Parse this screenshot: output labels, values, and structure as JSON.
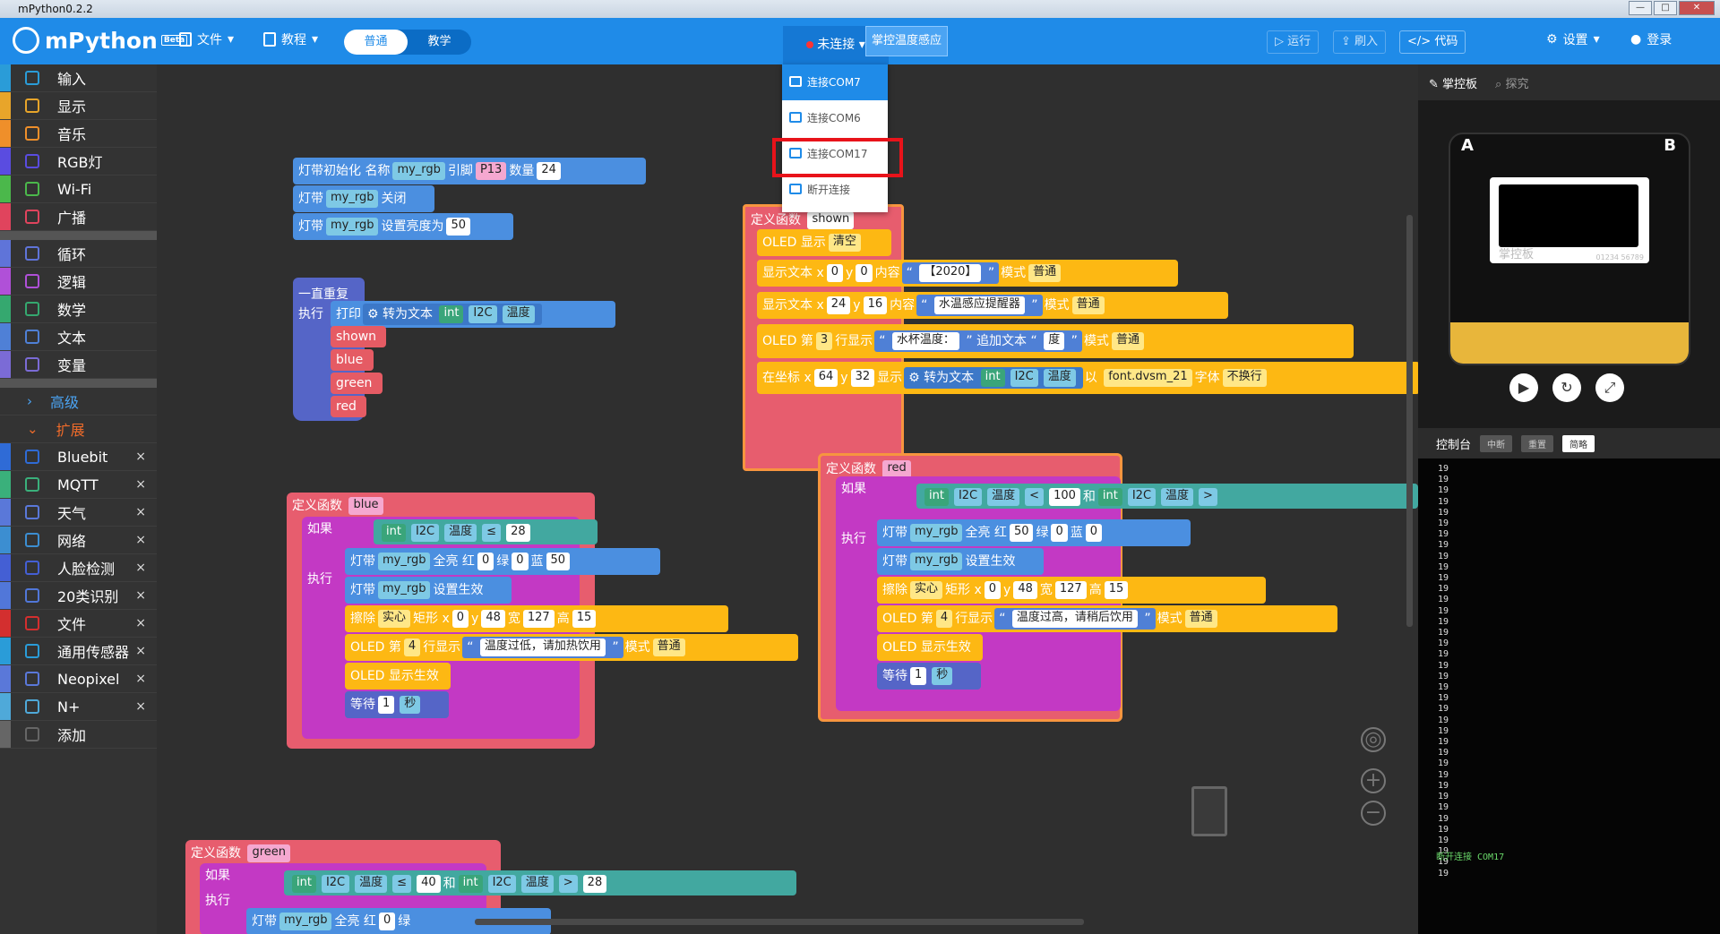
{
  "window": {
    "title": "mPython0.2.2"
  },
  "toolbar": {
    "logo": "mPython",
    "version": "Beta",
    "file": "文件",
    "tutorial": "教程",
    "mode_normal": "普通",
    "mode_teach": "教学",
    "connect": "未连接",
    "board": "掌控温度感应",
    "run": "运行",
    "flash": "刷入",
    "code": "代码",
    "settings": "设置",
    "login": "登录"
  },
  "dropdown": {
    "items": [
      "连接COM7",
      "连接COM6",
      "连接COM17",
      "断开连接"
    ]
  },
  "sidebar": {
    "items": [
      {
        "label": "输入",
        "color": "#2a9cd8"
      },
      {
        "label": "显示",
        "color": "#e8a52a"
      },
      {
        "label": "音乐",
        "color": "#ef8f2a"
      },
      {
        "label": "RGB灯",
        "color": "#5a4ce0"
      },
      {
        "label": "Wi-Fi",
        "color": "#4bb84b"
      },
      {
        "label": "广播",
        "color": "#e0445d"
      }
    ],
    "items2": [
      {
        "label": "循环",
        "color": "#5f74d9"
      },
      {
        "label": "逻辑",
        "color": "#b050d8"
      },
      {
        "label": "数学",
        "color": "#35a86f"
      },
      {
        "label": "文本",
        "color": "#4f80d6"
      },
      {
        "label": "变量",
        "color": "#7b6bd6"
      }
    ],
    "advanced": "高级",
    "extension": "扩展",
    "items3": [
      {
        "label": "Bluebit",
        "color": "#2f6bd6"
      },
      {
        "label": "MQTT",
        "color": "#3ab07b"
      },
      {
        "label": "天气",
        "color": "#5a78d9"
      },
      {
        "label": "网络",
        "color": "#3c8ed1"
      },
      {
        "label": "人脸检测",
        "color": "#445fd4"
      },
      {
        "label": "20类识别",
        "color": "#5177d9"
      },
      {
        "label": "文件",
        "color": "#d32f2f"
      },
      {
        "label": "通用传感器",
        "color": "#2a9cd8"
      },
      {
        "label": "Neopixel",
        "color": "#5a78d9"
      },
      {
        "label": "N+",
        "color": "#4fa9d9"
      },
      {
        "label": "添加",
        "color": "#666666"
      }
    ],
    "close": "×"
  },
  "blocks": {
    "init": {
      "t1": "灯带初始化 名称",
      "name": "my_rgb",
      "t2": "引脚",
      "pin": "P13",
      "t3": "数量",
      "n": "24"
    },
    "off": {
      "t1": "灯带",
      "name": "my_rgb",
      "t2": "关闭"
    },
    "bright": {
      "t1": "灯带",
      "name": "my_rgb",
      "t2": "设置亮度为",
      "v": "50"
    },
    "forever": "一直重复",
    "exec": "执行",
    "print": "打印",
    "totext": "转为文本",
    "int": "int",
    "i2c": "I2C",
    "temp": "温度",
    "args": [
      "shown",
      "blue",
      "green",
      "red"
    ],
    "func": "定义函数",
    "fn_shown": "shown",
    "fn_blue": "blue",
    "fn_red": "red",
    "fn_green": "green",
    "if": "如果",
    "and": "和",
    "lt": "<",
    "gt": ">",
    "le": "≤",
    "oled_show": "OLED 显示",
    "clear": "清空",
    "text": "显示文本 x",
    "y": "y",
    "content": "内容",
    "mode": "模式",
    "normal": "普通",
    "s2020": "【2020】",
    "water": "水温感应提醒器",
    "oled_line": "OLED 第",
    "line3": "3",
    "line4": "4",
    "row": "行显示",
    "cup": "水杯温度：",
    "append": "追加文本",
    "deg": "度",
    "coord": "在坐标 x",
    "show": "显示",
    "by": "以",
    "font": "font.dvsm_21",
    "font_t": "字体",
    "nowrap": "不换行",
    "full": "全亮 红",
    "green_t": "绿",
    "blue_t": "蓝",
    "apply": "设置生效",
    "erase": "擦除",
    "solid": "实心",
    "rect": "矩形 x",
    "w": "宽",
    "h": "高",
    "low": "温度过低，请加热饮用",
    "high": "温度过高，请稍后饮用",
    "oled_apply": "OLED 显示生效",
    "wait": "等待",
    "sec": "秒",
    "v0": "0",
    "v24": "24",
    "v16": "16",
    "v64": "64",
    "v32": "32",
    "v100": "100",
    "v28": "28",
    "v50": "50",
    "v48": "48",
    "v127": "127",
    "v15": "15",
    "v1": "1",
    "v40": "40"
  },
  "right": {
    "tab_board": "掌控板",
    "tab_explore": "探究",
    "a": "A",
    "b": "B",
    "brand": "掌控板",
    "code": "01234 56789",
    "console": "控制台",
    "interrupt": "中断",
    "reset": "重置",
    "simple": "简略",
    "disconnect": "断开连接  COM17",
    "value": "19"
  }
}
